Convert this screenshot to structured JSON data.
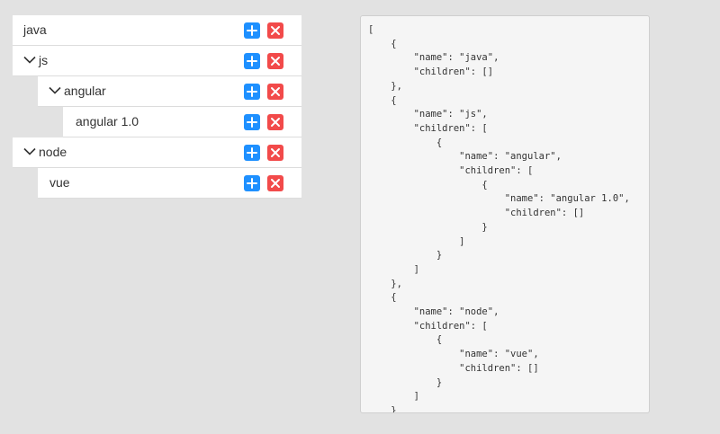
{
  "tree": {
    "nodes": [
      {
        "label": "java",
        "expanded": false
      },
      {
        "label": "js",
        "expanded": true
      },
      {
        "label": "angular",
        "expanded": true
      },
      {
        "label": "angular 1.0",
        "expanded": false
      },
      {
        "label": "node",
        "expanded": true
      },
      {
        "label": "vue",
        "expanded": false
      }
    ],
    "add_icon": "plus-icon",
    "delete_icon": "close-icon"
  },
  "json_view": {
    "text": "[\n    {\n        \"name\": \"java\",\n        \"children\": []\n    },\n    {\n        \"name\": \"js\",\n        \"children\": [\n            {\n                \"name\": \"angular\",\n                \"children\": [\n                    {\n                        \"name\": \"angular 1.0\",\n                        \"children\": []\n                    }\n                ]\n            }\n        ]\n    },\n    {\n        \"name\": \"node\",\n        \"children\": [\n            {\n                \"name\": \"vue\",\n                \"children\": []\n            }\n        ]\n    }\n]"
  },
  "colors": {
    "add": "#1e90ff",
    "delete": "#f24a4a",
    "background": "#e2e2e2",
    "panel": "#f5f5f5"
  }
}
